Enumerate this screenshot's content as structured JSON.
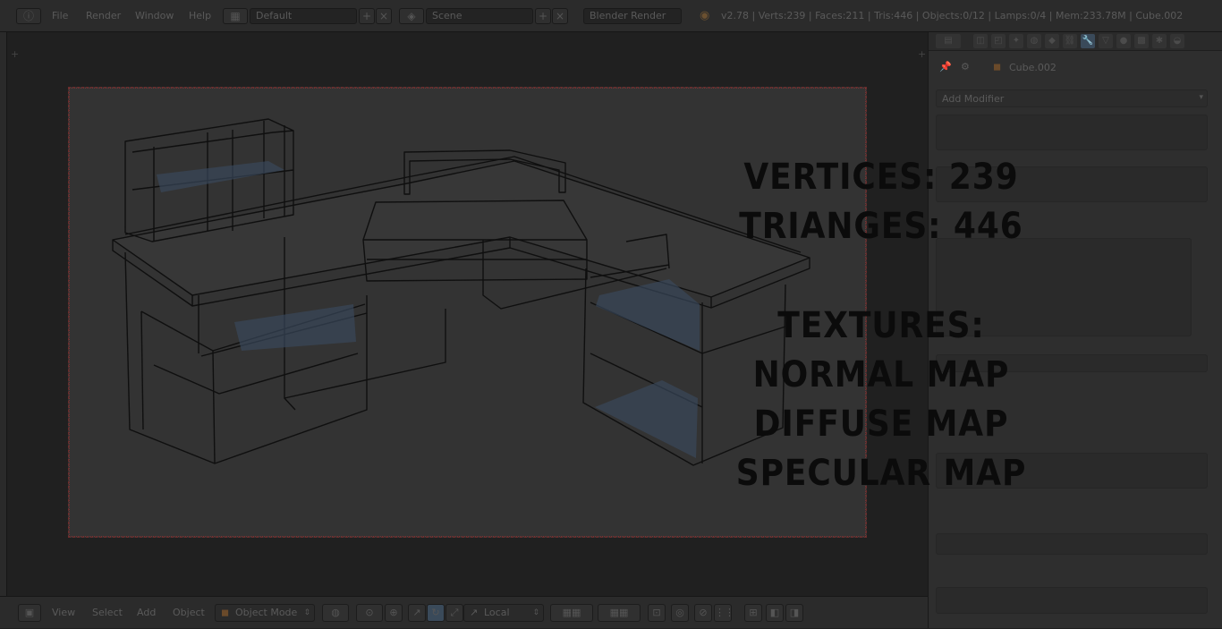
{
  "menu": {
    "file": "File",
    "render": "Render",
    "window": "Window",
    "help": "Help"
  },
  "screen_layout": "Default",
  "scene": "Scene",
  "render_engine": "Blender Render",
  "status": "v2.78 | Verts:239 | Faces:211 | Tris:446 | Objects:0/12 | Lamps:0/4 | Mem:233.78M | Cube.002",
  "properties": {
    "object_name": "Cube.002",
    "add_modifier": "Add Modifier"
  },
  "overlay": {
    "line1": "VERTICES: 239",
    "line2": "TRIANGES: 446",
    "line3": "TEXTURES:",
    "line4": "NORMAL MAP",
    "line5": "DIFFUSE MAP",
    "line6": "SPECULAR MAP"
  },
  "footer": {
    "view": "View",
    "select": "Select",
    "add": "Add",
    "object": "Object",
    "mode": "Object Mode",
    "orientation": "Local"
  },
  "icons": {
    "info": "info-icon",
    "layout": "layout-icon",
    "scene": "scene-icon",
    "blender_logo": "blender-logo-icon",
    "pin": "pin-icon",
    "cube": "cube-icon"
  }
}
